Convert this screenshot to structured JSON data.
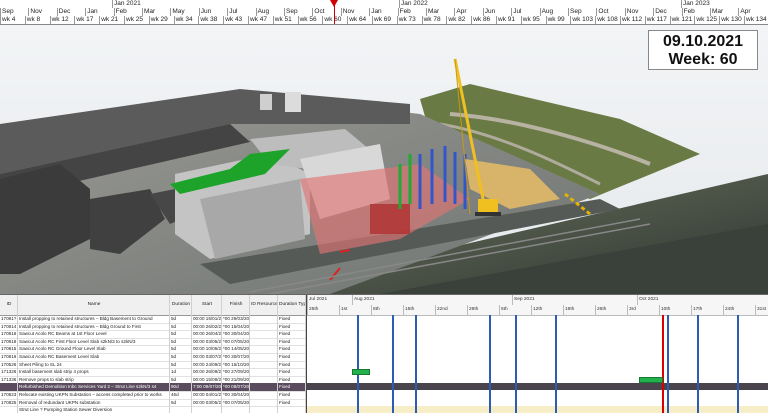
{
  "timeline": {
    "years": [
      {
        "label": "Jan 2021"
      },
      {
        "label": "Jan 2022"
      },
      {
        "label": "Jan 2023"
      }
    ],
    "months": [
      "Oct",
      "Nov",
      "Dec",
      "Jan",
      "Feb",
      "Apr",
      "May",
      "Jun",
      "Jul",
      "Aug",
      "Oct",
      "Nov",
      "Dec",
      "Feb",
      "Mar",
      "Apr",
      "May",
      "Jul",
      "Aug",
      "Sep",
      "Oct",
      "Dec",
      "Jan",
      "Feb",
      "Apr",
      "May"
    ],
    "months2": [
      "Sep",
      "Nov",
      "Dec",
      "Jan",
      "Feb",
      "Mar",
      "May",
      "Jun",
      "Jul",
      "Aug",
      "Sep",
      "Oct",
      "Nov",
      "Jan",
      "Feb",
      "Mar",
      "Apr",
      "Jun",
      "Jul",
      "Aug",
      "Sep",
      "Oct",
      "Nov",
      "Dec",
      "Feb",
      "Mar",
      "Apr"
    ],
    "weeks": [
      "wk 4",
      "wk 8",
      "wk 12",
      "wk 17",
      "wk 21",
      "wk 25",
      "wk 29",
      "wk 34",
      "wk 38",
      "wk 43",
      "wk 47",
      "wk 51",
      "wk 56",
      "wk 60",
      "wk 64",
      "wk 69",
      "wk 73",
      "wk 78",
      "wk 82",
      "wk 86",
      "wk 91",
      "wk 95",
      "wk 99",
      "wk 103",
      "wk 108",
      "wk 112",
      "wk 117",
      "wk 121",
      "wk 125",
      "wk 130",
      "wk 134"
    ]
  },
  "datebox": {
    "date": "09.10.2021",
    "week": "Week: 60"
  },
  "colors": {
    "crane": "#f0c020",
    "green_roof": "#1ea32a",
    "red_zone": "#e07575",
    "accent_blue": "#2d5cb5",
    "today_red": "#d00000"
  },
  "gantt": {
    "headers": [
      "ID",
      "Name",
      "Duration",
      "Start",
      "Finish",
      "ID Resources",
      "Duration Type"
    ],
    "rows": [
      [
        "17081?",
        "Install propping to retained structures – Bldg Basement to Ground",
        "5d",
        "00:00 15/01/2021",
        "*00 29/03/2021",
        "",
        "Fixed"
      ],
      [
        "170814",
        "Install propping to retained structures – Bldg Ground to First",
        "5d",
        "00:00 26/02/2021",
        "*00 15/04/2021",
        "",
        "Fixed"
      ],
      [
        "170816",
        "Sawcut Acolo RC Beams at 1st Floor Level",
        "5d",
        "00:00 26/04/2021",
        "*00 30/04/2021",
        "",
        "Fixed"
      ],
      [
        "170818",
        "Sawcut Acolo RC First Floor Level Slab s2kN/3 to s2kN/3",
        "5d",
        "00:00 03/05/2021",
        "*00 07/05/2021",
        "",
        "Fixed"
      ],
      [
        "170815",
        "Sawcut Acolo RC Ground Floor Level Slab",
        "5d",
        "00:00 10/05/2021",
        "*00 14/05/2021",
        "",
        "Fixed"
      ],
      [
        "170816",
        "Sawcut Acolo RC Basement Level Slab",
        "5d",
        "00:00 03/07/2021",
        "*00 30/07/2021",
        "",
        "Fixed"
      ],
      [
        "170526",
        "Sheet Piling to SL 24",
        "5d",
        "00:00 24/09/2021",
        "*00 15/10/2021",
        "",
        "Fixed"
      ],
      [
        "171326",
        "Install basement slab strip 4 props",
        "1d",
        "00:00 26/09/2021",
        "*00 27/09/2021",
        "",
        "Fixed"
      ],
      [
        "171336",
        "Remove props to slab strip",
        "5d",
        "00:00 15/09/2021",
        "*00 21/09/2021",
        "",
        "Fixed"
      ],
      [
        "",
        "Refurbished Demolition Inbc Services Yard 2 – Strut Line s2kN/3 s4",
        "90d",
        "7:00 09/07/2021",
        "*00 08/07/2022",
        "",
        "Fixed"
      ],
      [
        "170823",
        "Relocate existing UKPN Substation – access completed prior to works",
        "46d",
        "00:00 04/01/2021",
        "*00 30/04/2021",
        "",
        "Fixed"
      ],
      [
        "170825",
        "Removal of redundant UKPN substation",
        "5d",
        "00:00 03/05/2021",
        "*00 07/05/2021",
        "",
        "Fixed"
      ],
      [
        "",
        "Strut Line ? Pumping Station Sewer Diversion",
        "",
        "",
        "",
        "",
        ""
      ]
    ],
    "selected_row": 9,
    "months": [
      "Jul 2021",
      "Aug 2021",
      "Sep 2021",
      "Oct 2021"
    ],
    "days": [
      "25th",
      "1st",
      "8th",
      "15th",
      "22nd",
      "29th",
      "5th",
      "12th",
      "19th",
      "26th",
      "3rd",
      "10th",
      "17th",
      "24th",
      "31st",
      "7th",
      "14th",
      "21st",
      "28th",
      "5th"
    ],
    "weeks": [
      "wk 49",
      "wk 50",
      "wk 51",
      "wk 52",
      "wk 53",
      "wk 54",
      "wk 55",
      "wk 56",
      "wk 57",
      "wk 58",
      "wk 59",
      "wk 60",
      "wk 61",
      "wk 62",
      "wk 63"
    ]
  }
}
